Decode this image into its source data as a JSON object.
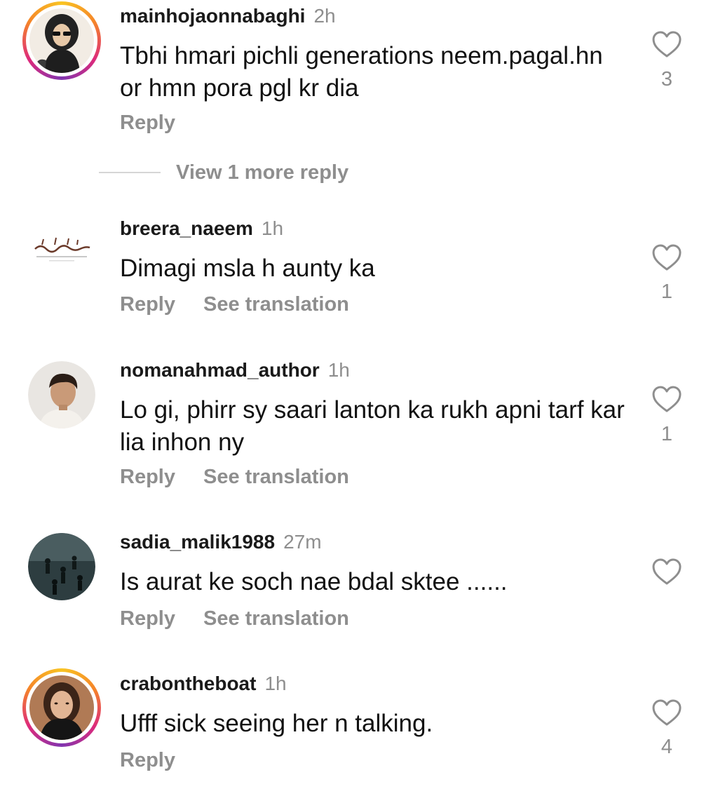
{
  "comments": [
    {
      "username": "mainhojaonnabaghi",
      "time": "2h",
      "text": "Tbhi hmari pichli generations neem.pagal.hn or hmn pora pgl kr dia",
      "reply": "Reply",
      "likes": "3",
      "avatar_icon": "woman-sunglasses-avatar",
      "story_ring": true
    },
    {
      "username": "breera_naeem",
      "time": "1h",
      "text": "Dimagi msla h aunty ka",
      "reply": "Reply",
      "translate": "See translation",
      "likes": "1",
      "avatar_icon": "arabic-calligraphy-avatar",
      "story_ring": false
    },
    {
      "username": "nomanahmad_author",
      "time": "1h",
      "text": "Lo gi, phirr sy saari lanton ka rukh apni tarf kar lia inhon ny",
      "reply": "Reply",
      "translate": "See translation",
      "likes": "1",
      "avatar_icon": "young-man-avatar",
      "story_ring": false
    },
    {
      "username": "sadia_malik1988",
      "time": "27m",
      "text": "Is aurat ke soch nae bdal sktee ......",
      "reply": "Reply",
      "translate": "See translation",
      "likes": "",
      "avatar_icon": "crowd-scene-avatar",
      "story_ring": false
    },
    {
      "username": "crabontheboat",
      "time": "1h",
      "text": "Ufff sick seeing her n talking.",
      "reply": "Reply",
      "likes": "4",
      "avatar_icon": "woman-portrait-avatar",
      "story_ring": true
    }
  ],
  "view_more": "View 1 more reply",
  "colors": {
    "text": "#111111",
    "muted": "#8e8e8e",
    "ring_gradient": [
      "#f9c423",
      "#f58529",
      "#dd2a7b",
      "#8134af"
    ]
  }
}
